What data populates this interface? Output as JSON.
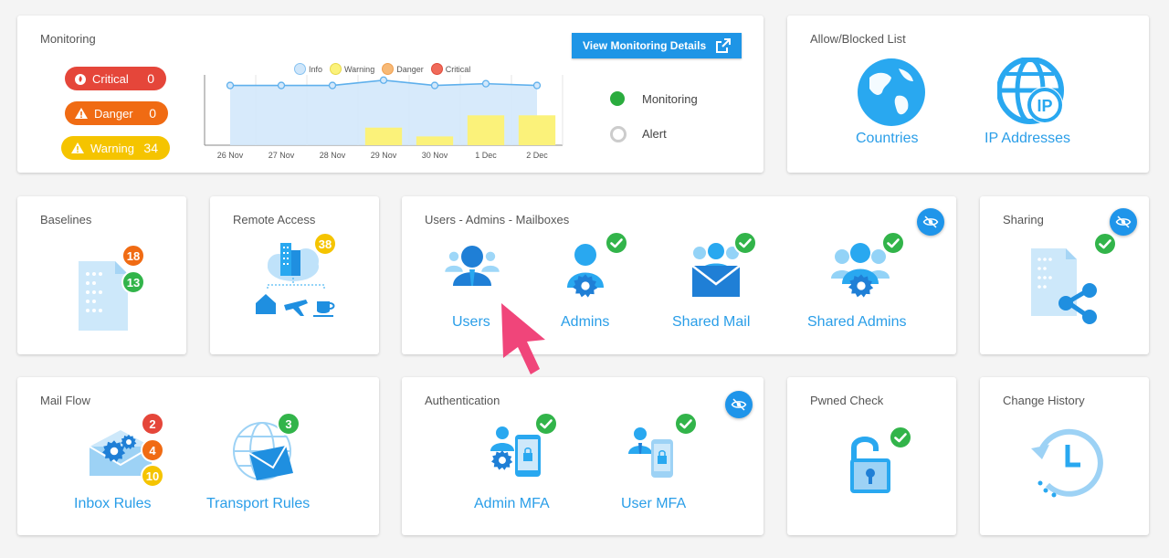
{
  "colors": {
    "accent": "#1e95e6",
    "icon_blue": "#29a8f0",
    "critical": "#e5463a",
    "danger": "#f06b13",
    "warning": "#f5c400",
    "ok": "#32b44a"
  },
  "monitoring": {
    "title": "Monitoring",
    "critical": {
      "label": "Critical",
      "value": "0"
    },
    "danger": {
      "label": "Danger",
      "value": "0"
    },
    "warning": {
      "label": "Warning",
      "value": "34"
    },
    "details_button": "View Monitoring Details",
    "status_monitoring": "Monitoring",
    "status_alert": "Alert"
  },
  "chart_data": {
    "type": "line",
    "categories": [
      "26 Nov",
      "27 Nov",
      "28 Nov",
      "29 Nov",
      "30 Nov",
      "1 Dec",
      "2 Dec"
    ],
    "legend": [
      "Info",
      "Warning",
      "Danger",
      "Critical"
    ],
    "series": [
      {
        "name": "Info",
        "values": [
          34,
          34,
          34,
          37,
          34,
          35,
          34
        ]
      },
      {
        "name": "Warning",
        "values": [
          0,
          0,
          0,
          10,
          5,
          17,
          17
        ]
      },
      {
        "name": "Danger",
        "values": [
          0,
          0,
          0,
          0,
          0,
          0,
          0
        ]
      },
      {
        "name": "Critical",
        "values": [
          0,
          0,
          0,
          0,
          0,
          0,
          0
        ]
      }
    ],
    "ylim": [
      0,
      40
    ]
  },
  "allow_blocked": {
    "title": "Allow/Blocked List",
    "countries": "Countries",
    "ip_addresses": "IP Addresses"
  },
  "baselines": {
    "title": "Baselines",
    "badge_top": "18",
    "badge_bottom": "13"
  },
  "remote_access": {
    "title": "Remote Access",
    "badge": "38"
  },
  "users_admins": {
    "title": "Users - Admins - Mailboxes",
    "users": "Users",
    "admins": "Admins",
    "shared_mail": "Shared Mail",
    "shared_admins": "Shared Admins"
  },
  "sharing": {
    "title": "Sharing"
  },
  "mail_flow": {
    "title": "Mail Flow",
    "inbox_rules": "Inbox Rules",
    "transport_rules": "Transport Rules",
    "badge_red": "2",
    "badge_orange": "4",
    "badge_yellow": "10",
    "badge_green": "3"
  },
  "authentication": {
    "title": "Authentication",
    "admin_mfa": "Admin MFA",
    "user_mfa": "User MFA"
  },
  "pwned": {
    "title": "Pwned Check"
  },
  "change_history": {
    "title": "Change History"
  }
}
